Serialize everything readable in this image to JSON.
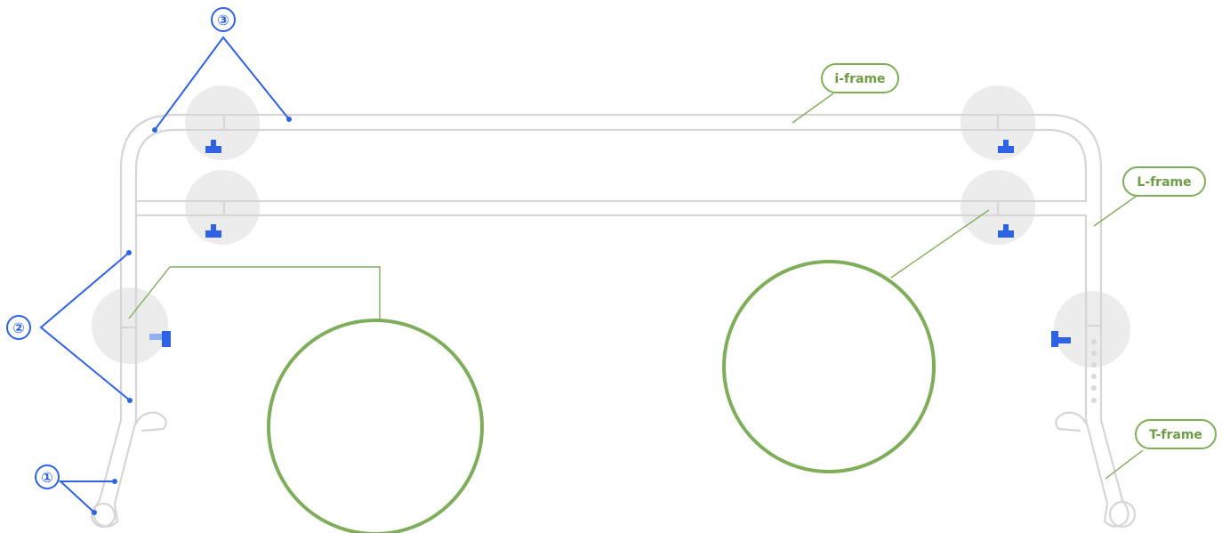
{
  "diagram": {
    "callouts": {
      "one": "①",
      "two": "②",
      "three": "③"
    },
    "labels": {
      "i_frame": "i-frame",
      "l_frame": "L-frame",
      "t_frame": "T-frame"
    },
    "colors": {
      "callout_blue": "#2f63e6",
      "label_green": "#7fae5a",
      "frame_gray": "#d6d6d6",
      "joint_gray": "#ececec",
      "wood": "#d9986a",
      "knob_black": "#1f1f1f"
    },
    "icons": {
      "detail_left": "knob-bolt-and-tube-with-holes",
      "detail_right": "wood-plank-tube-and-knob"
    }
  }
}
